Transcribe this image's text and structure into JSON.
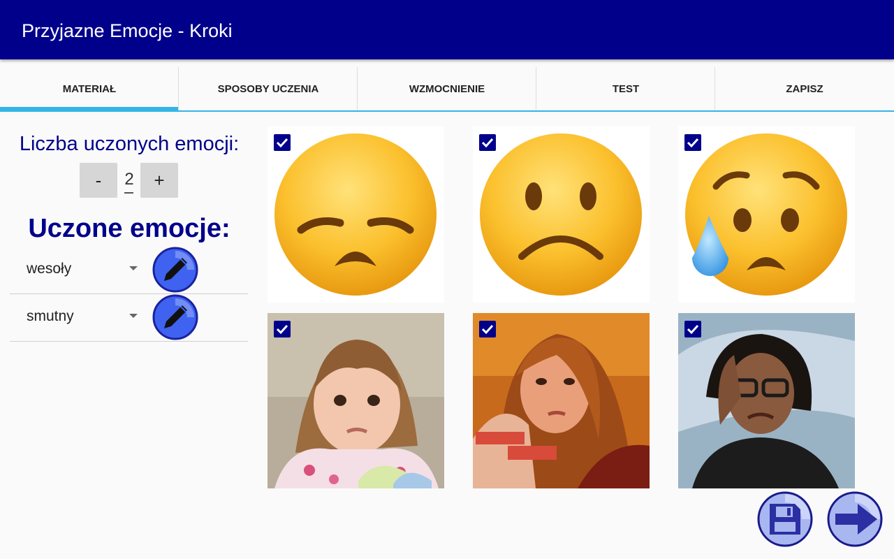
{
  "app": {
    "title": "Przyjazne Emocje - Kroki"
  },
  "tabs": [
    {
      "label": "MATERIAŁ",
      "active": true
    },
    {
      "label": "SPOSOBY UCZENIA",
      "active": false
    },
    {
      "label": "WZMOCNIENIE",
      "active": false
    },
    {
      "label": "TEST",
      "active": false
    },
    {
      "label": "ZAPISZ",
      "active": false
    }
  ],
  "sidebar": {
    "count_label": "Liczba uczonych emocji:",
    "decrement_label": "-",
    "count_value": "2",
    "increment_label": "+",
    "emotions_title": "Uczone emocje:",
    "emotions": [
      {
        "value": "wesoły"
      },
      {
        "value": "smutny"
      }
    ]
  },
  "gallery": {
    "images": [
      {
        "kind": "emoji-disappointed-face",
        "checked": true
      },
      {
        "kind": "emoji-slightly-frowning-face",
        "checked": true
      },
      {
        "kind": "emoji-sad-but-relieved-face",
        "checked": true
      },
      {
        "kind": "photo-sad-toddler",
        "checked": true
      },
      {
        "kind": "photo-sad-young-woman",
        "checked": true
      },
      {
        "kind": "photo-crying-woman-with-glasses",
        "checked": true
      }
    ]
  },
  "colors": {
    "appbar": "#00008b",
    "tab_indicator": "#33b5e5",
    "heading_text": "#00008b",
    "checkbox": "#00008b",
    "fab_fill": "#a9b7f0",
    "fab_icon": "#2b2fa3"
  },
  "actions": {
    "save_icon": "floppy-disk-icon",
    "next_icon": "arrow-right-icon",
    "edit_icon": "pencil-icon"
  }
}
